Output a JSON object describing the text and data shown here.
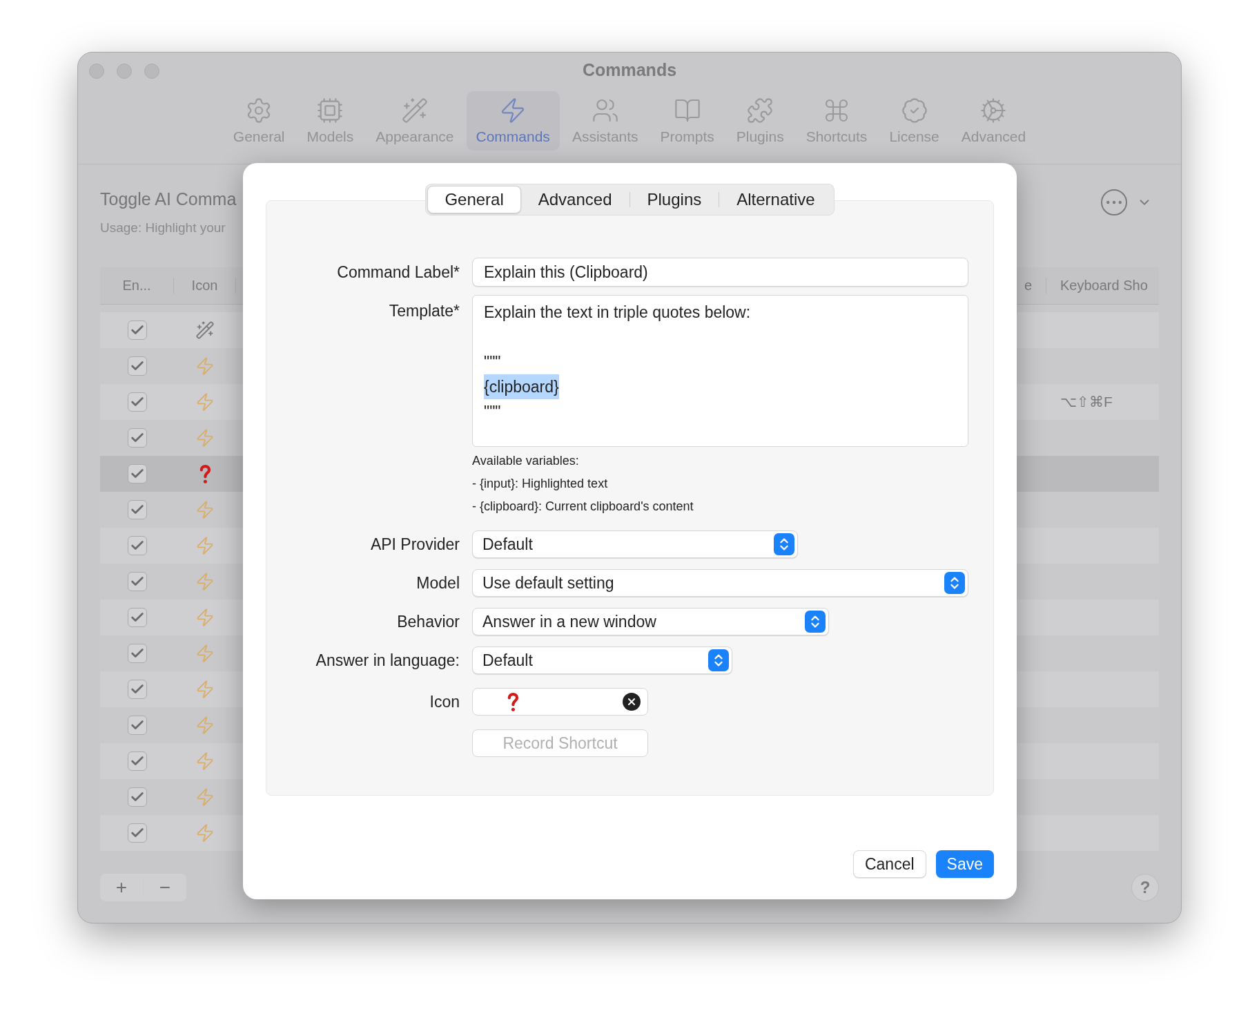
{
  "window": {
    "title": "Commands"
  },
  "toolbar": [
    {
      "label": "General",
      "selected": false
    },
    {
      "label": "Models",
      "selected": false
    },
    {
      "label": "Appearance",
      "selected": false
    },
    {
      "label": "Commands",
      "selected": true
    },
    {
      "label": "Assistants",
      "selected": false
    },
    {
      "label": "Prompts",
      "selected": false
    },
    {
      "label": "Plugins",
      "selected": false
    },
    {
      "label": "Shortcuts",
      "selected": false
    },
    {
      "label": "License",
      "selected": false
    },
    {
      "label": "Advanced",
      "selected": false
    }
  ],
  "page": {
    "title": "Toggle AI Comma",
    "usage": "Usage: Highlight your"
  },
  "table": {
    "columns": [
      "En...",
      "Icon",
      "e",
      "Keyboard Sho"
    ],
    "rows": [
      {
        "enabled": true,
        "kind": "wand",
        "selected": false
      },
      {
        "enabled": true,
        "kind": "bolt",
        "selected": false
      },
      {
        "enabled": true,
        "kind": "bolt",
        "selected": false,
        "shortcut": "⌥⇧⌘F"
      },
      {
        "enabled": true,
        "kind": "bolt",
        "selected": false
      },
      {
        "enabled": true,
        "kind": "question",
        "selected": true
      },
      {
        "enabled": true,
        "kind": "bolt",
        "selected": false
      },
      {
        "enabled": true,
        "kind": "bolt",
        "selected": false
      },
      {
        "enabled": true,
        "kind": "bolt",
        "selected": false
      },
      {
        "enabled": true,
        "kind": "bolt",
        "selected": false
      },
      {
        "enabled": true,
        "kind": "bolt",
        "selected": false
      },
      {
        "enabled": true,
        "kind": "bolt",
        "selected": false
      },
      {
        "enabled": true,
        "kind": "bolt",
        "selected": false
      },
      {
        "enabled": true,
        "kind": "bolt",
        "selected": false
      },
      {
        "enabled": true,
        "kind": "bolt",
        "selected": false
      },
      {
        "enabled": true,
        "kind": "bolt",
        "selected": false
      }
    ]
  },
  "footer": {
    "add": "+",
    "remove": "−",
    "help": "?"
  },
  "dialog": {
    "tabs": [
      {
        "label": "General",
        "selected": true
      },
      {
        "label": "Advanced",
        "selected": false
      },
      {
        "label": "Plugins",
        "selected": false
      },
      {
        "label": "Alternative",
        "selected": false
      }
    ],
    "command_label": {
      "label": "Command Label*",
      "value": "Explain this (Clipboard)"
    },
    "template": {
      "label": "Template*",
      "lines": [
        {
          "text": "Explain the text in triple quotes below:",
          "selected": false
        },
        {
          "text": "\"\"\"",
          "selected": false
        },
        {
          "text": "{clipboard}",
          "selected": true
        },
        {
          "text": "\"\"\"",
          "selected": false
        }
      ]
    },
    "variables": [
      "Available variables:",
      "- {input}: Highlighted text",
      "- {clipboard}: Current clipboard's content"
    ],
    "selects": [
      {
        "label": "API Provider",
        "value": "Default"
      },
      {
        "label": "Model",
        "value": "Use default setting"
      },
      {
        "label": "Behavior",
        "value": "Answer in a new window"
      },
      {
        "label": "Answer in language:",
        "value": "Default"
      }
    ],
    "icon_field": {
      "label": "Icon",
      "kind": "question"
    },
    "record_shortcut": {
      "label": "Record Shortcut",
      "disabled": true
    },
    "buttons": [
      {
        "label": "Cancel",
        "kind": "secondary"
      },
      {
        "label": "Save",
        "kind": "primary"
      }
    ]
  }
}
